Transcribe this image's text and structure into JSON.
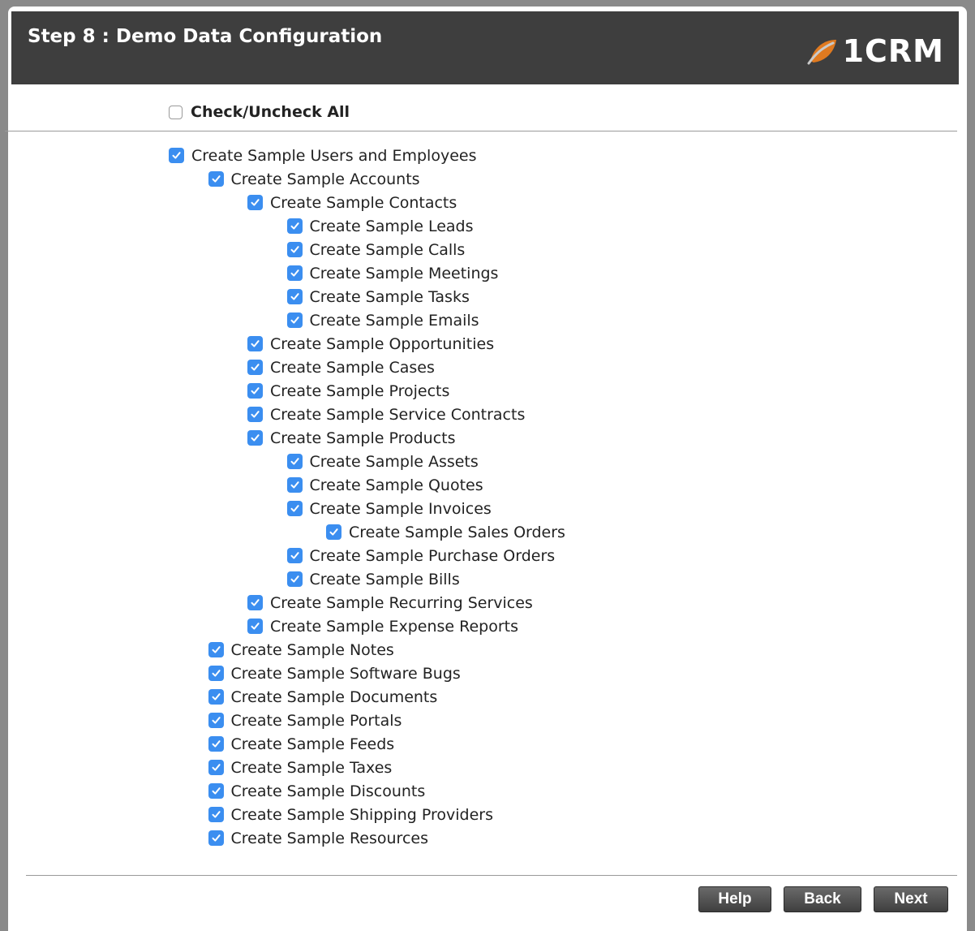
{
  "header": {
    "title": "Step 8 : Demo Data Configuration",
    "logo_text": "1CRM",
    "logo_color": "#e07a20"
  },
  "check_all": {
    "label": "Check/Uncheck All",
    "checked": false
  },
  "accent_color": "#3b8ef0",
  "items": [
    {
      "label": "Create Sample Users and Employees",
      "level": 0,
      "checked": true
    },
    {
      "label": "Create Sample Accounts",
      "level": 1,
      "checked": true
    },
    {
      "label": "Create Sample Contacts",
      "level": 2,
      "checked": true
    },
    {
      "label": "Create Sample Leads",
      "level": 3,
      "checked": true
    },
    {
      "label": "Create Sample Calls",
      "level": 3,
      "checked": true
    },
    {
      "label": "Create Sample Meetings",
      "level": 3,
      "checked": true
    },
    {
      "label": "Create Sample Tasks",
      "level": 3,
      "checked": true
    },
    {
      "label": "Create Sample Emails",
      "level": 3,
      "checked": true
    },
    {
      "label": "Create Sample Opportunities",
      "level": 2,
      "checked": true
    },
    {
      "label": "Create Sample Cases",
      "level": 2,
      "checked": true
    },
    {
      "label": "Create Sample Projects",
      "level": 2,
      "checked": true
    },
    {
      "label": "Create Sample Service Contracts",
      "level": 2,
      "checked": true
    },
    {
      "label": "Create Sample Products",
      "level": 2,
      "checked": true
    },
    {
      "label": "Create Sample Assets",
      "level": 3,
      "checked": true
    },
    {
      "label": "Create Sample Quotes",
      "level": 3,
      "checked": true
    },
    {
      "label": "Create Sample Invoices",
      "level": 3,
      "checked": true
    },
    {
      "label": "Create Sample Sales Orders",
      "level": 4,
      "checked": true
    },
    {
      "label": "Create Sample Purchase Orders",
      "level": 3,
      "checked": true
    },
    {
      "label": "Create Sample Bills",
      "level": 3,
      "checked": true
    },
    {
      "label": "Create Sample Recurring Services",
      "level": 2,
      "checked": true
    },
    {
      "label": "Create Sample Expense Reports",
      "level": 2,
      "checked": true
    },
    {
      "label": "Create Sample Notes",
      "level": 1,
      "checked": true
    },
    {
      "label": "Create Sample Software Bugs",
      "level": 1,
      "checked": true
    },
    {
      "label": "Create Sample Documents",
      "level": 1,
      "checked": true
    },
    {
      "label": "Create Sample Portals",
      "level": 1,
      "checked": true
    },
    {
      "label": "Create Sample Feeds",
      "level": 1,
      "checked": true
    },
    {
      "label": "Create Sample Taxes",
      "level": 1,
      "checked": true
    },
    {
      "label": "Create Sample Discounts",
      "level": 1,
      "checked": true
    },
    {
      "label": "Create Sample Shipping Providers",
      "level": 1,
      "checked": true
    },
    {
      "label": "Create Sample Resources",
      "level": 1,
      "checked": true
    }
  ],
  "buttons": {
    "help": "Help",
    "back": "Back",
    "next": "Next"
  }
}
